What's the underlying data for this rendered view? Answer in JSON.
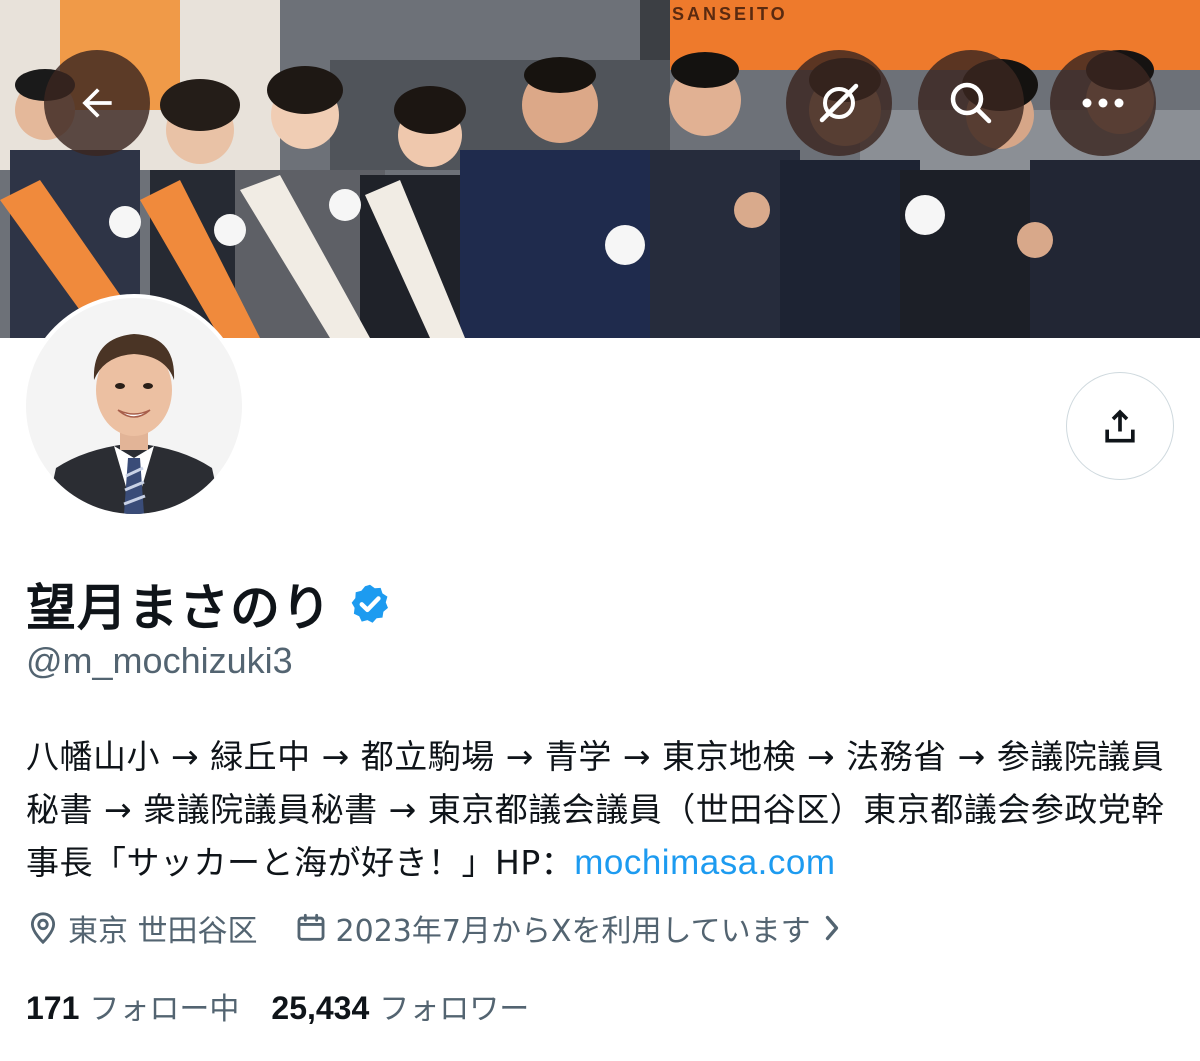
{
  "banner": {
    "sign_text": "SANSEITO"
  },
  "nav": {
    "back_icon": "arrow-left-icon",
    "grok_icon": "grok-icon",
    "search_icon": "search-icon",
    "more_icon": "more-horizontal-icon"
  },
  "actions": {
    "share_icon": "share-icon"
  },
  "profile": {
    "display_name": "望月まさのり",
    "handle": "@m_mochizuki3",
    "bio_text": "八幡山小 → 緑丘中 → 都立駒場 → 青学 → 東京地検 → 法務省 → 参議院議員秘書 → 衆議院議員秘書 → 東京都議会議員（世田谷区）東京都議会参政党幹事長「サッカーと海が好き！」HP：",
    "bio_link": "mochimasa.com",
    "location": "東京 世田谷区",
    "joined": "2023年7月からXを利用しています",
    "following_count": "171",
    "following_label": "フォロー中",
    "followers_count": "25,434",
    "followers_label": "フォロワー"
  },
  "colors": {
    "link": "#1d9bf0",
    "secondary_text": "#536471",
    "primary_text": "#0f1419",
    "verified_badge": "#1d9bf0"
  }
}
